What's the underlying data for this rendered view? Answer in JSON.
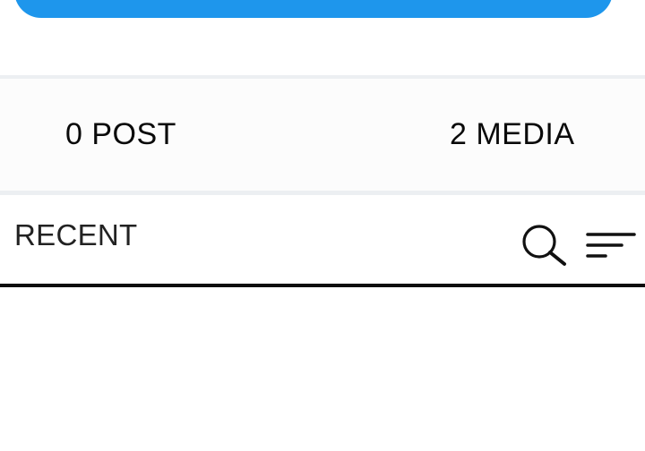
{
  "colors": {
    "accent": "#1e96ec",
    "divider": "#0d0d0d",
    "band": "#eceff2"
  },
  "stats": {
    "posts_label": "0 POST",
    "media_label": "2 MEDIA"
  },
  "recent": {
    "title": "RECENT",
    "search_icon": "search-icon",
    "filter_icon": "sort-filter-icon"
  }
}
